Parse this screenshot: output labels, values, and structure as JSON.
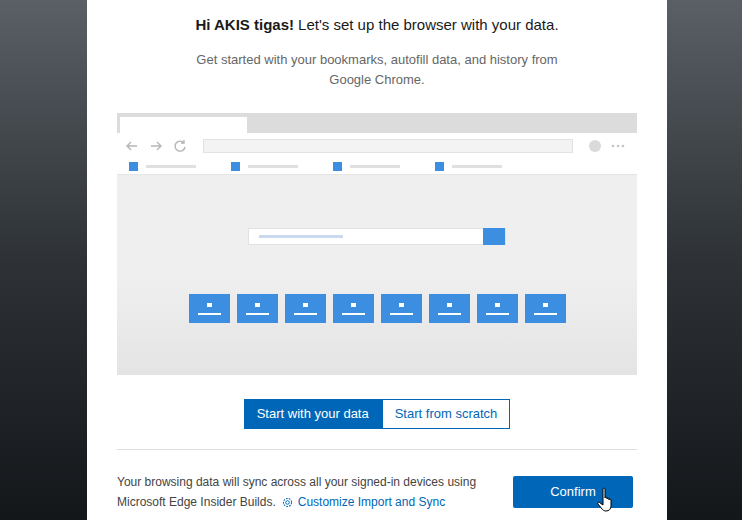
{
  "dialog": {
    "greeting": "Hi AKIS tigas!",
    "heading": "Let's set up the browser with your data.",
    "subtitle_lines": [
      "Get started with your bookmarks, autofill data, and history from",
      "Google Chrome."
    ]
  },
  "options": [
    {
      "label": "Start with your data",
      "selected": true
    },
    {
      "label": "Start from scratch",
      "selected": false
    }
  ],
  "footer": {
    "lines": [
      "Your browsing data will sync across all your signed-in devices using",
      "Microsoft Edge Insider Builds."
    ],
    "link": "Customize Import and Sync"
  },
  "buttons": [
    "Confirm"
  ]
}
